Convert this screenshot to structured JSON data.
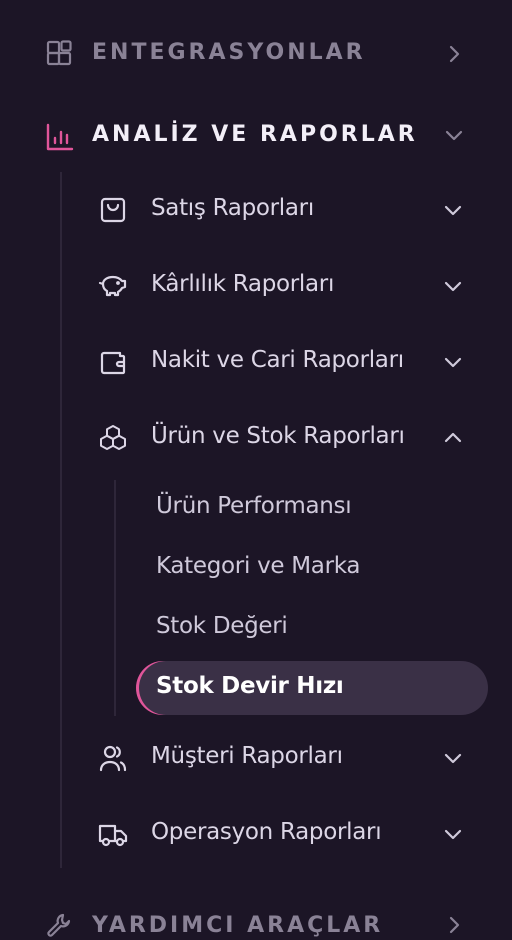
{
  "menu": {
    "integrations": {
      "label": "ENTEGRASYONLAR",
      "icon": "apps-icon"
    },
    "analytics": {
      "label": "ANALİZ VE RAPORLAR",
      "icon": "bar-chart-icon",
      "items": [
        {
          "label": "Satış Raporları",
          "icon": "shopping-bag-icon",
          "expanded": false
        },
        {
          "label": "Kârlılık Raporları",
          "icon": "piggy-bank-icon",
          "expanded": false
        },
        {
          "label": "Nakit ve Cari Raporları",
          "icon": "wallet-icon",
          "expanded": false
        },
        {
          "label": "Ürün ve Stok Raporları",
          "icon": "boxes-icon",
          "expanded": true,
          "children": [
            {
              "label": "Ürün Performansı",
              "active": false
            },
            {
              "label": "Kategori ve Marka",
              "active": false
            },
            {
              "label": "Stok Değeri",
              "active": false
            },
            {
              "label": "Stok Devir Hızı",
              "active": true
            }
          ]
        },
        {
          "label": "Müşteri Raporları",
          "icon": "users-icon",
          "expanded": false
        },
        {
          "label": "Operasyon Raporları",
          "icon": "truck-icon",
          "expanded": false
        }
      ]
    },
    "tools": {
      "label": "YARDIMCI ARAÇLAR",
      "icon": "wrench-icon"
    }
  },
  "colors": {
    "background": "#1c1526",
    "accent": "#e0559a",
    "active_item_bg": "#3a3046",
    "muted_text": "#8a8296"
  }
}
